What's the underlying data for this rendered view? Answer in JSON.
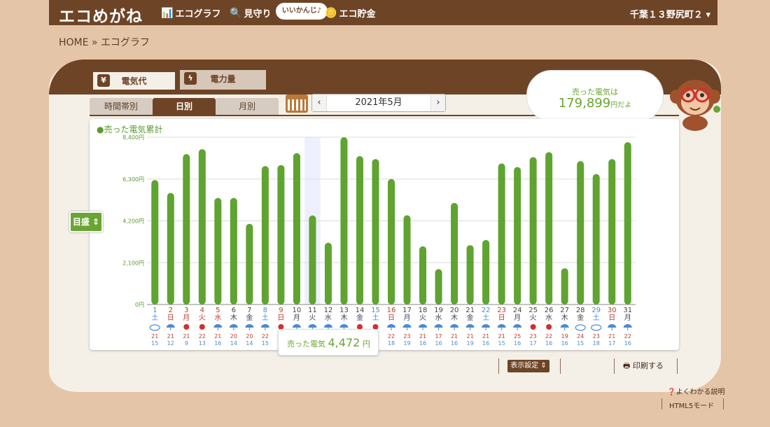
{
  "header": {
    "logo": "エコめがね",
    "nav": [
      {
        "label": "エコグラフ",
        "icon": "bar-chart-icon"
      },
      {
        "label": "見守り",
        "icon": "magnifier-icon"
      },
      {
        "label": "エコ貯金",
        "icon": "coin-icon"
      }
    ],
    "badge": "いいかんじ♪",
    "location": "千葉１３野尻町２"
  },
  "breadcrumb": "HOME » エコグラフ",
  "tabs": {
    "cost": "電気代",
    "kwh": "電力量"
  },
  "period_tabs": [
    "時間帯別",
    "日別",
    "月別"
  ],
  "date": "2021年5月",
  "summary": {
    "label": "売った電気は",
    "value": "179,899",
    "suffix": "円だよ"
  },
  "legend": "●売った電気累計",
  "meyasu": "目盛 ⇕",
  "tooltip": {
    "label": "売った電気",
    "value": "4,472",
    "unit": "円"
  },
  "footer": {
    "display": "表示設定 ⇕",
    "print": "印刷する",
    "help": "よくわかる説明",
    "html5": "HTML5モード"
  },
  "chart_data": {
    "type": "bar",
    "y_unit": "円",
    "ylim": [
      0,
      8400
    ],
    "yticks": [
      "0円",
      "2,100円",
      "4,200円",
      "6,300円",
      "8,400円"
    ],
    "days": [
      "1",
      "2",
      "3",
      "4",
      "5",
      "6",
      "7",
      "8",
      "9",
      "10",
      "11",
      "12",
      "13",
      "14",
      "15",
      "16",
      "17",
      "18",
      "19",
      "20",
      "21",
      "22",
      "23",
      "24",
      "25",
      "26",
      "27",
      "28",
      "29",
      "30",
      "31"
    ],
    "weekdays": [
      "土",
      "日",
      "月",
      "火",
      "水",
      "木",
      "金",
      "土",
      "日",
      "月",
      "火",
      "水",
      "木",
      "金",
      "土",
      "日",
      "月",
      "火",
      "水",
      "木",
      "金",
      "土",
      "日",
      "月",
      "火",
      "水",
      "木",
      "金",
      "土",
      "日",
      "月"
    ],
    "day_colors": [
      "#4a8ad4",
      "#c0392b",
      "#c0392b",
      "#c0392b",
      "#c0392b",
      "#444444",
      "#444444",
      "#4a8ad4",
      "#c0392b",
      "#444444",
      "#444444",
      "#444444",
      "#444444",
      "#444444",
      "#4a8ad4",
      "#c0392b",
      "#444444",
      "#444444",
      "#444444",
      "#444444",
      "#444444",
      "#4a8ad4",
      "#c0392b",
      "#444444",
      "#444444",
      "#444444",
      "#444444",
      "#444444",
      "#4a8ad4",
      "#c0392b",
      "#444444"
    ],
    "weather": [
      "cloud",
      "rain",
      "sun",
      "sun",
      "rain",
      "rain",
      "rain",
      "rain",
      "sun",
      "rain",
      "rain",
      "rain",
      "rain",
      "sun",
      "sun",
      "rain",
      "rain",
      "rain",
      "rain",
      "rain",
      "rain",
      "rain",
      "rain",
      "rain",
      "sun",
      "sun",
      "rain",
      "cloud",
      "cloud",
      "rain",
      "rain"
    ],
    "high_temp": [
      "21",
      "21",
      "21",
      "22",
      "21",
      "20",
      "20",
      "22",
      "",
      "",
      "",
      "",
      "",
      "",
      "",
      "22",
      "23",
      "21",
      "17",
      "21",
      "21",
      "21",
      "21",
      "25",
      "23",
      "22",
      "19",
      "24",
      "23",
      "21",
      "22"
    ],
    "low_temp": [
      "15",
      "12",
      "9",
      "13",
      "16",
      "14",
      "14",
      "15",
      "",
      "",
      "",
      "",
      "",
      "",
      "",
      "18",
      "19",
      "16",
      "16",
      "16",
      "19",
      "16",
      "15",
      "16",
      "17",
      "16",
      "16",
      "15",
      "18",
      "17",
      "16"
    ],
    "values": [
      6250,
      5600,
      7550,
      7800,
      5350,
      5350,
      4050,
      6950,
      7000,
      7600,
      4472,
      3100,
      8400,
      7450,
      7300,
      6300,
      4480,
      2920,
      1780,
      5100,
      2980,
      3240,
      7080,
      6900,
      7400,
      7650,
      1820,
      7200,
      6550,
      7300,
      8150
    ],
    "highlight_index": 10,
    "bar_color": "#5fa330"
  }
}
